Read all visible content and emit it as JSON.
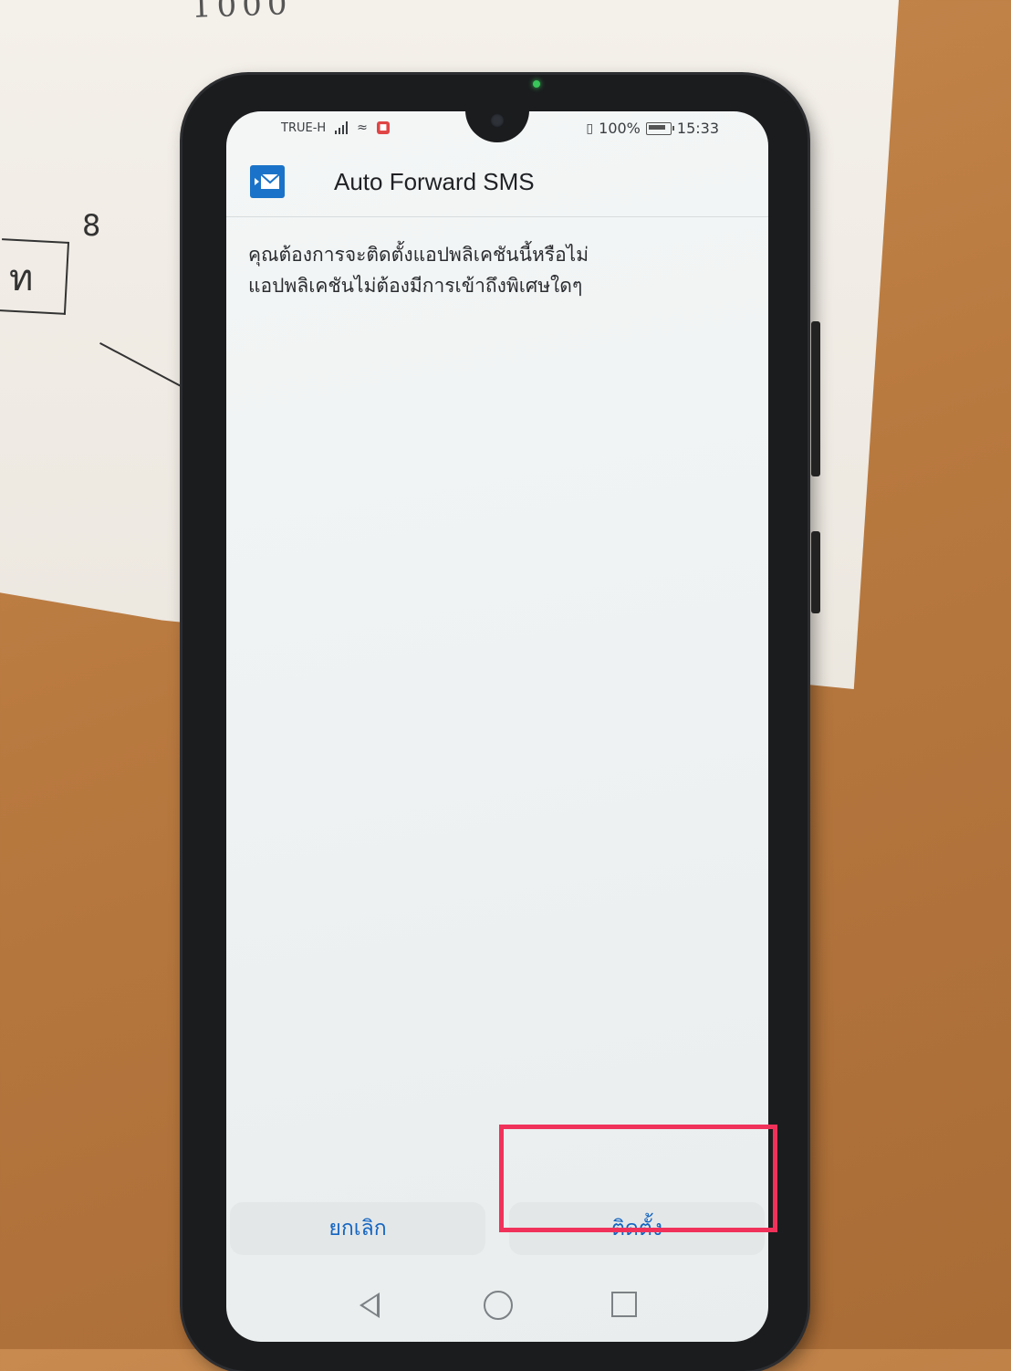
{
  "paper": {
    "top_note": "1000",
    "box_char": "ท",
    "star": "8"
  },
  "statusbar": {
    "carrier": "TRUE-H",
    "battery": "100%",
    "time": "15:33"
  },
  "app": {
    "title": "Auto Forward SMS",
    "icon_name": "sms-forward-icon",
    "icon_color": "#1a73c8"
  },
  "dialog": {
    "line1": "คุณต้องการจะติดตั้งแอปพลิเคชันนี้หรือไม่",
    "line2": "แอปพลิเคชันไม่ต้องมีการเข้าถึงพิเศษใดๆ",
    "cancel_label": "ยกเลิก",
    "install_label": "ติดตั้ง",
    "button_text_color": "#1565c0",
    "highlight_color": "#f0325a"
  },
  "navbar": {
    "back_icon": "back-icon",
    "home_icon": "home-icon",
    "recent_icon": "recent-apps-icon"
  }
}
